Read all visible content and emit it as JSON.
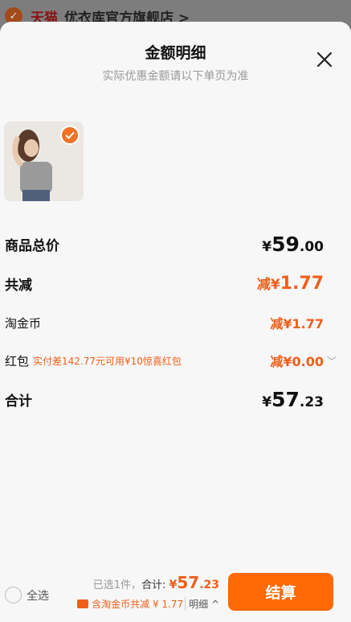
{
  "background": {
    "tmall": "天猫",
    "store_name": "优衣库官方旗舰店 >"
  },
  "sheet": {
    "title": "金额明细",
    "subtitle": "实际优惠金额请以下单页为准",
    "close_icon": "close-icon"
  },
  "rows": {
    "total": {
      "label": "商品总价",
      "prefix": "¥",
      "int": "59",
      "dec": ".00"
    },
    "discount": {
      "label": "共减",
      "prefix": "减¥",
      "int": "1.77"
    },
    "coins": {
      "label": "淘金币",
      "value": "减¥1.77"
    },
    "redpacket": {
      "label": "红包",
      "hint": "实付差142.77元可用¥10惊喜红包",
      "value": "减¥0.00"
    },
    "subtotal": {
      "label": "合计",
      "prefix": "¥",
      "int": "57",
      "dec": ".23"
    }
  },
  "footer": {
    "select_all": "全选",
    "selected": "已选1件，",
    "total_label": "合计:",
    "amount_prefix": "¥",
    "amount_int": "57",
    "amount_dec": ".23",
    "coin_text": "含淘金币共减 ¥ 1.77",
    "detail": "明细 ^",
    "settle": "结算"
  },
  "colors": {
    "accent": "#f05f1a",
    "button": "#ff6a07"
  }
}
